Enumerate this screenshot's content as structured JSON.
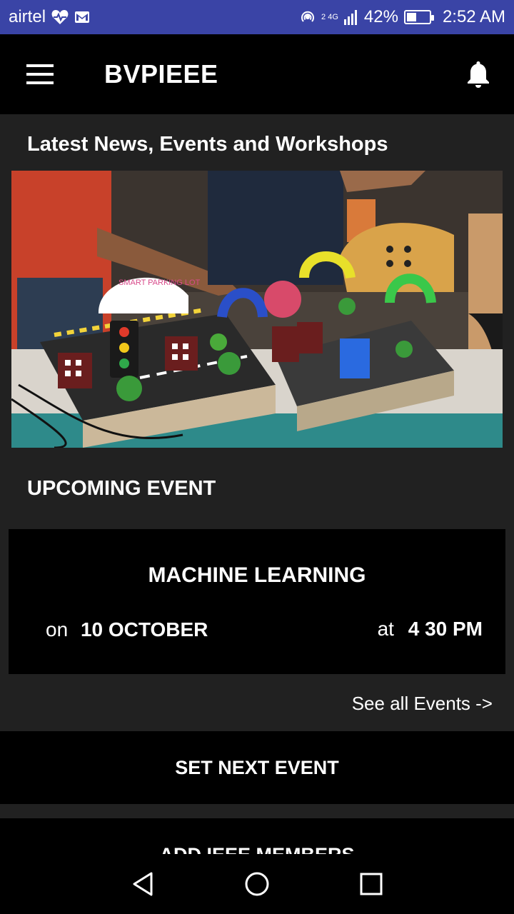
{
  "status_bar": {
    "carrier": "airtel",
    "network": "2 4G",
    "battery": "42%",
    "battery_level": 0.42,
    "time": "2:52 AM"
  },
  "app_bar": {
    "title": "BVPIEEE",
    "menu_icon": "hamburger-menu-icon",
    "notification_icon": "bell-icon"
  },
  "news": {
    "heading": "Latest News, Events and Workshops",
    "image_sign_text": "SMART PARKING LOT",
    "slide_count": 13,
    "active_slide": 0
  },
  "upcoming": {
    "heading": "UPCOMING EVENT",
    "event_name": "MACHINE LEARNING",
    "date_prefix": "on",
    "date": "10 OCTOBER",
    "time_prefix": "at",
    "time": "4 30 PM"
  },
  "see_all_label": "See all Events ->",
  "buttons": {
    "set_next_event": "SET NEXT EVENT",
    "add_members": "ADD IEEE MEMBERS"
  },
  "nav_bar": {
    "back_icon": "back-triangle-icon",
    "home_icon": "home-circle-icon",
    "recents_icon": "recents-square-icon"
  },
  "colors": {
    "status_bar": "#3a44a6",
    "app_bar": "#000000",
    "background": "#212121",
    "card": "#000000",
    "text": "#ffffff"
  }
}
